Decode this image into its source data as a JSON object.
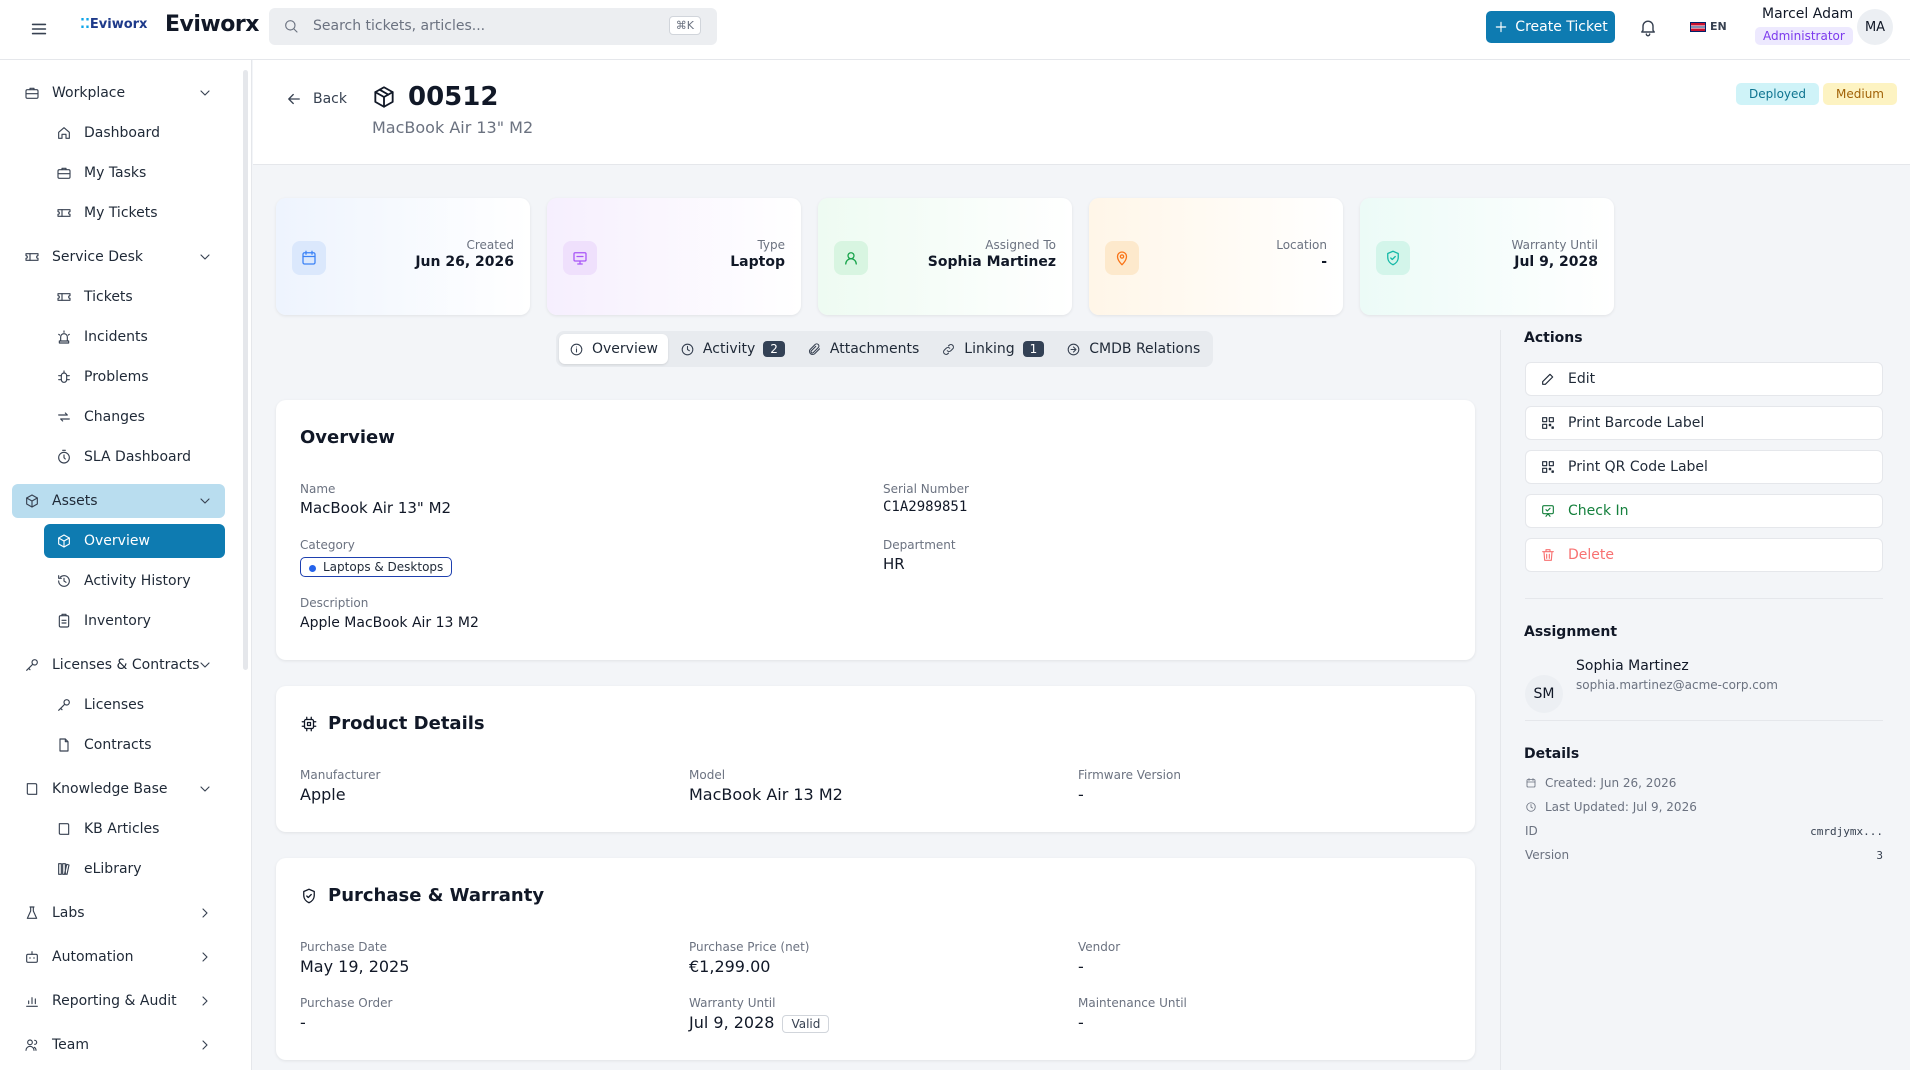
{
  "topbar": {
    "logo_small": "Eviworx",
    "logo_big": "Eviworx",
    "search_placeholder": "Search tickets, articles...",
    "search_shortcut": "⌘K",
    "create_ticket": "Create Ticket",
    "language": "EN",
    "user_name": "Marcel Adam",
    "user_role": "Administrator",
    "user_initials": "MA"
  },
  "sidebar": {
    "workplace": "Workplace",
    "dashboard": "Dashboard",
    "my_tasks": "My Tasks",
    "my_tickets": "My Tickets",
    "service_desk": "Service Desk",
    "tickets": "Tickets",
    "incidents": "Incidents",
    "problems": "Problems",
    "changes": "Changes",
    "sla_dashboard": "SLA Dashboard",
    "assets": "Assets",
    "overview": "Overview",
    "activity_history": "Activity History",
    "inventory": "Inventory",
    "licenses_contracts": "Licenses & Contracts",
    "licenses": "Licenses",
    "contracts": "Contracts",
    "knowledge_base": "Knowledge Base",
    "kb_articles": "KB Articles",
    "elibrary": "eLibrary",
    "labs": "Labs",
    "automation": "Automation",
    "reporting_audit": "Reporting & Audit",
    "team": "Team"
  },
  "header": {
    "back": "Back",
    "title": "00512",
    "subtitle": "MacBook Air 13\" M2",
    "status_badge": "Deployed",
    "priority_badge": "Medium"
  },
  "stats": {
    "created_label": "Created",
    "created_value": "Jun 26, 2026",
    "type_label": "Type",
    "type_value": "Laptop",
    "assigned_label": "Assigned To",
    "assigned_value": "Sophia Martinez",
    "location_label": "Location",
    "location_value": "-",
    "warranty_label": "Warranty Until",
    "warranty_value": "Jul 9, 2028"
  },
  "tabs": {
    "overview": "Overview",
    "activity": "Activity",
    "activity_count": "2",
    "attachments": "Attachments",
    "linking": "Linking",
    "linking_count": "1",
    "cmdb": "CMDB Relations"
  },
  "overview_card": {
    "title": "Overview",
    "name_label": "Name",
    "name_value": "MacBook Air 13\" M2",
    "serial_label": "Serial Number",
    "serial_value": "C1A2989851",
    "category_label": "Category",
    "category_value": "Laptops & Desktops",
    "department_label": "Department",
    "department_value": "HR",
    "description_label": "Description",
    "description_value": "Apple MacBook Air 13 M2"
  },
  "product_card": {
    "title": "Product Details",
    "manufacturer_label": "Manufacturer",
    "manufacturer_value": "Apple",
    "model_label": "Model",
    "model_value": "MacBook Air 13 M2",
    "firmware_label": "Firmware Version",
    "firmware_value": "-"
  },
  "purchase_card": {
    "title": "Purchase & Warranty",
    "purchase_date_label": "Purchase Date",
    "purchase_date_value": "May 19, 2025",
    "price_label": "Purchase Price (net)",
    "price_value": "€1,299.00",
    "vendor_label": "Vendor",
    "vendor_value": "-",
    "order_label": "Purchase Order",
    "order_value": "-",
    "warranty_label": "Warranty Until",
    "warranty_value": "Jul 9, 2028",
    "warranty_status": "Valid",
    "maintenance_label": "Maintenance Until",
    "maintenance_value": "-"
  },
  "right_panel": {
    "actions_title": "Actions",
    "edit": "Edit",
    "print_barcode": "Print Barcode Label",
    "print_qr": "Print QR Code Label",
    "check_in": "Check In",
    "delete": "Delete",
    "assignment_title": "Assignment",
    "assignee_initials": "SM",
    "assignee_name": "Sophia Martinez",
    "assignee_email": "sophia.martinez@acme-corp.com",
    "details_title": "Details",
    "created": "Created: Jun 26, 2026",
    "last_updated": "Last Updated: Jul 9, 2026",
    "id_label": "ID",
    "id_value": "cmrdjymx...",
    "version_label": "Version",
    "version_value": "3"
  },
  "colors": {
    "primary": "#0e7bb1",
    "active_group": "#b9ddef",
    "deployed_bg": "#cff3f8",
    "medium_bg": "#fdf3c2",
    "success": "#15803d",
    "danger": "#f87171"
  }
}
